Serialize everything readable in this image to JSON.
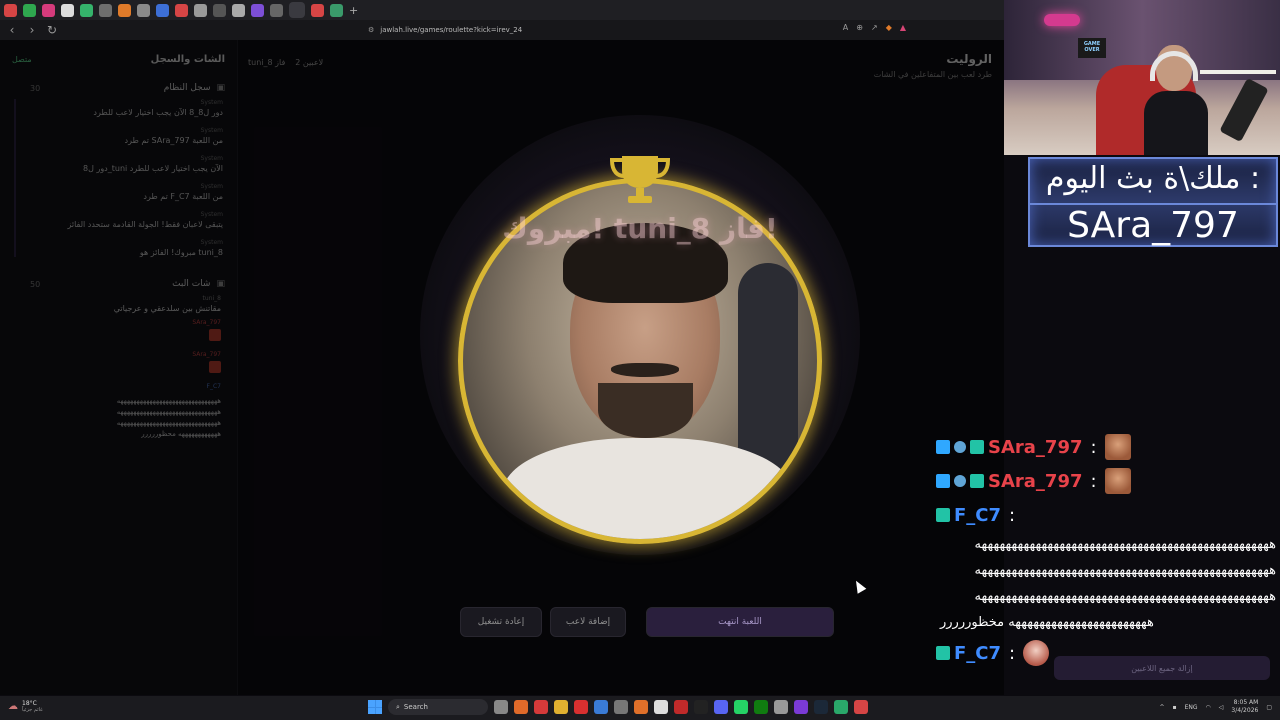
{
  "browser": {
    "url": "jawlah.live/games/roulette?kick=irev_24"
  },
  "sidebar": {
    "title": "الشات والسجل",
    "connection": "متصل",
    "system_log_title": "سجل النظام",
    "system_log_count": "30",
    "system_log": [
      {
        "meta": "System",
        "text": "دور ل8_8 الآن يجب اختيار لاعب للطرد"
      },
      {
        "meta": "System",
        "text": "تم طرد SAra_797 من اللعبة"
      },
      {
        "meta": "System",
        "text": "دور ل8_tuni الآن يجب اختيار لاعب للطرد"
      },
      {
        "meta": "System",
        "text": "تم طرد F_C7 من اللعبة"
      },
      {
        "meta": "System",
        "text": "يتبقى لاعبان فقط! الجولة القادمة ستحدد الفائز"
      },
      {
        "meta": "System",
        "text": "مبروك! الفائز هو tuni_8"
      }
    ],
    "live_chat_title": "شات البث",
    "live_chat_count": "50",
    "live_chat": [
      {
        "meta": "tuni_8",
        "text": "مقاتنش بين سلدعقي و عرجياتي"
      },
      {
        "meta": "SAra_797",
        "text": ""
      },
      {
        "meta": "SAra_797",
        "text": ""
      },
      {
        "meta": "F_C7",
        "text": ""
      }
    ],
    "spam_lines": [
      "هههههههههههههههههههههههههههههههه",
      "هههههههههههههههههههههههههههههههه",
      "هههههههههههههههههههههههههههههههه",
      "ههههههههههههه محظوررررر"
    ]
  },
  "main": {
    "title": "الروليت",
    "subtitle": "طرد لعب بين المتفاعلين في الشات",
    "players_count": "2 لاعبين",
    "current_player": "tuni_8 فاز",
    "winner_text": "مبروك! tuni_8 فاز!",
    "btn_end": "اللعبة انتهت",
    "btn_add": "إضافة لاعب",
    "btn_reset": "إعادة تشغيل",
    "btn_remove_all": "إزالة جميع اللاعبين"
  },
  "overlay": {
    "king_label": "ملك\\ة بث اليوم :",
    "king_name": "SAra_797",
    "chat": [
      {
        "user": "SAra_797",
        "color": "#e8434a",
        "emote": true
      },
      {
        "user": "SAra_797",
        "color": "#e8434a",
        "emote": true
      },
      {
        "user": "F_C7",
        "color": "#3f8cff",
        "emote": false
      }
    ],
    "spam": [
      "هههههههههههههههههههههههههههههههههههههههههههههههههه",
      "هههههههههههههههههههههههههههههههههههههههههههههههههه",
      "هههههههههههههههههههههههههههههههههههههههههههههههههه",
      "هههههههههههههههههههههههه مخظوررررر"
    ],
    "last_user": "F_C7"
  },
  "taskbar": {
    "temp": "18°C",
    "weather": "غائم جزئياً",
    "search": "Search",
    "lang": "ENG",
    "time": "8:05 AM",
    "date": "3/4/2026"
  }
}
